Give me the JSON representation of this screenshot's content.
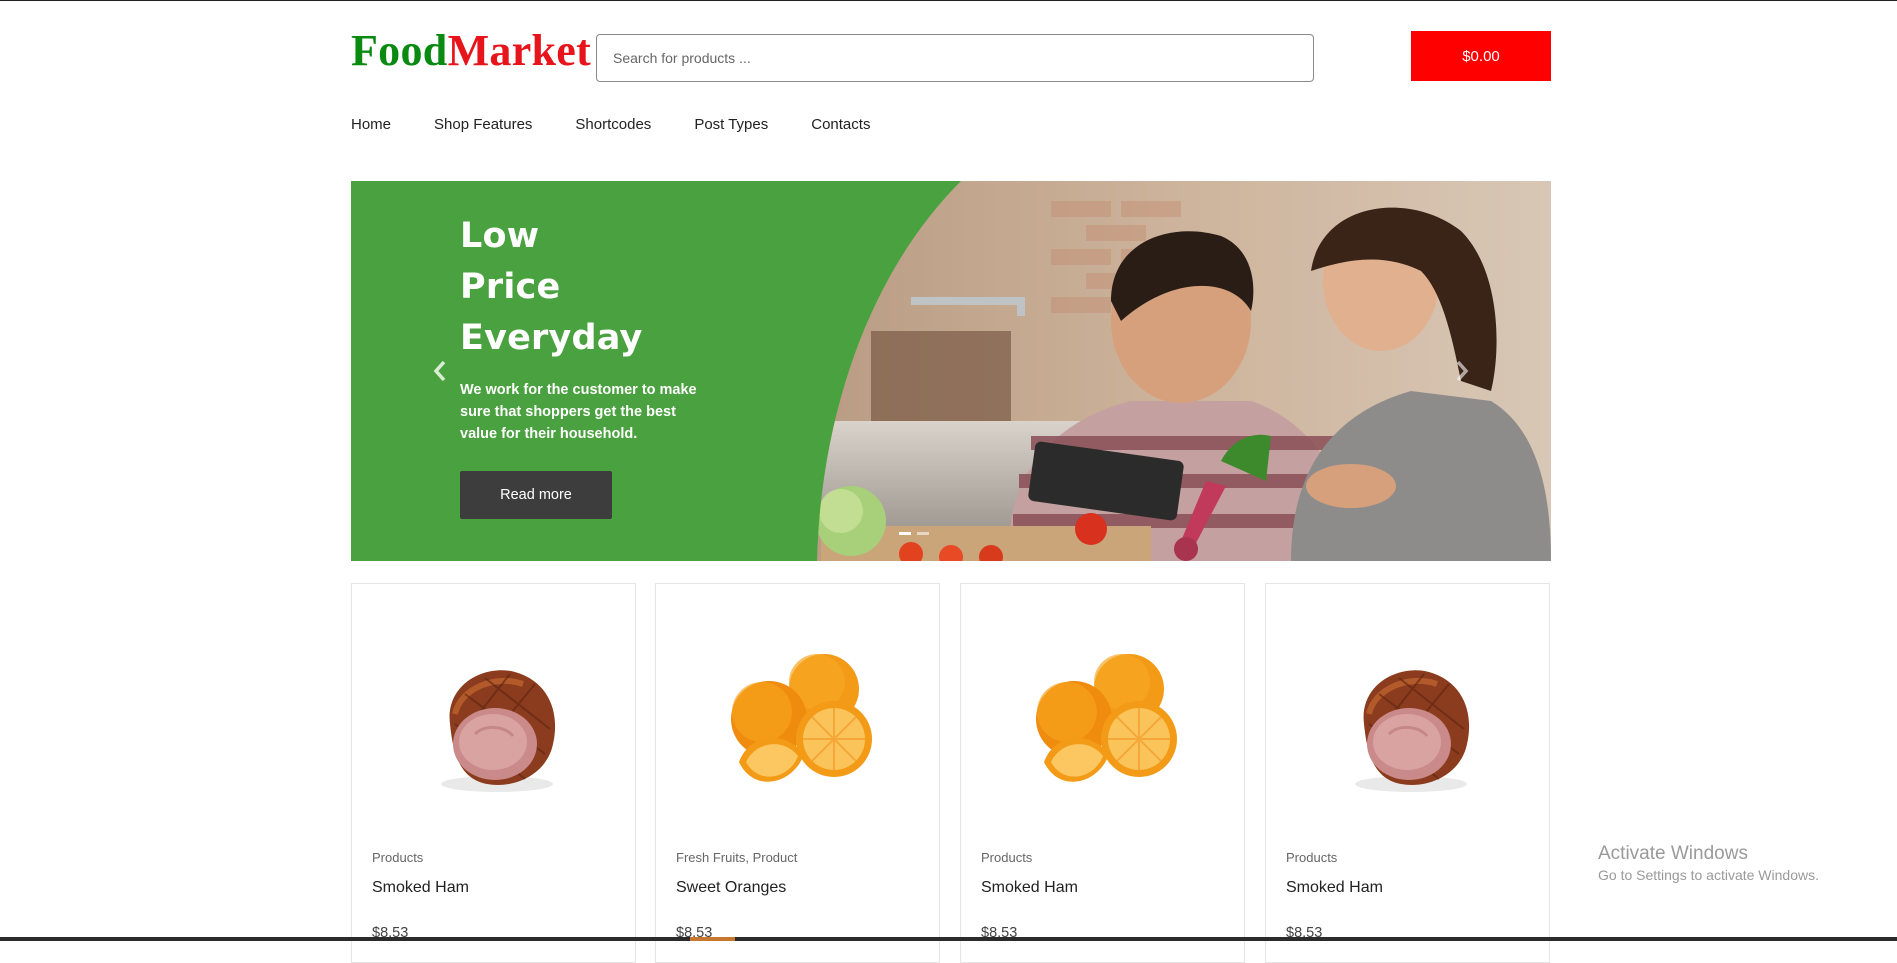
{
  "header": {
    "logo_part1": "Food",
    "logo_part2": "Market",
    "search_placeholder": "Search for products ...",
    "cart_total": "$0.00"
  },
  "nav": {
    "items": [
      "Home",
      "Shop Features",
      "Shortcodes",
      "Post Types",
      "Contacts"
    ]
  },
  "hero": {
    "title_lines": [
      "Low",
      "Price",
      "Everyday"
    ],
    "description": "We work for the customer to make sure that shoppers get the best value for their household.",
    "button_label": "Read more",
    "prev_icon": "chevron-left-icon",
    "next_icon": "chevron-right-icon"
  },
  "products": [
    {
      "category": "Products",
      "name": "Smoked Ham",
      "price": "$8.53",
      "image": "smoked-ham"
    },
    {
      "category": "Fresh Fruits, Product",
      "name": "Sweet Oranges",
      "price": "$8.53",
      "image": "sweet-oranges"
    },
    {
      "category": "Products",
      "name": "Smoked Ham",
      "price": "$8.53",
      "image": "sweet-oranges"
    },
    {
      "category": "Products",
      "name": "Smoked Ham",
      "price": "$8.53",
      "image": "smoked-ham"
    }
  ],
  "os_watermark": {
    "line1": "Activate Windows",
    "line2": "Go to Settings to activate Windows."
  },
  "colors": {
    "logo_green": "#0b8a12",
    "logo_red": "#e8141c",
    "cart_red": "#ff0000",
    "hero_green": "#4aa13f",
    "button_dark": "#3d3d3d"
  }
}
